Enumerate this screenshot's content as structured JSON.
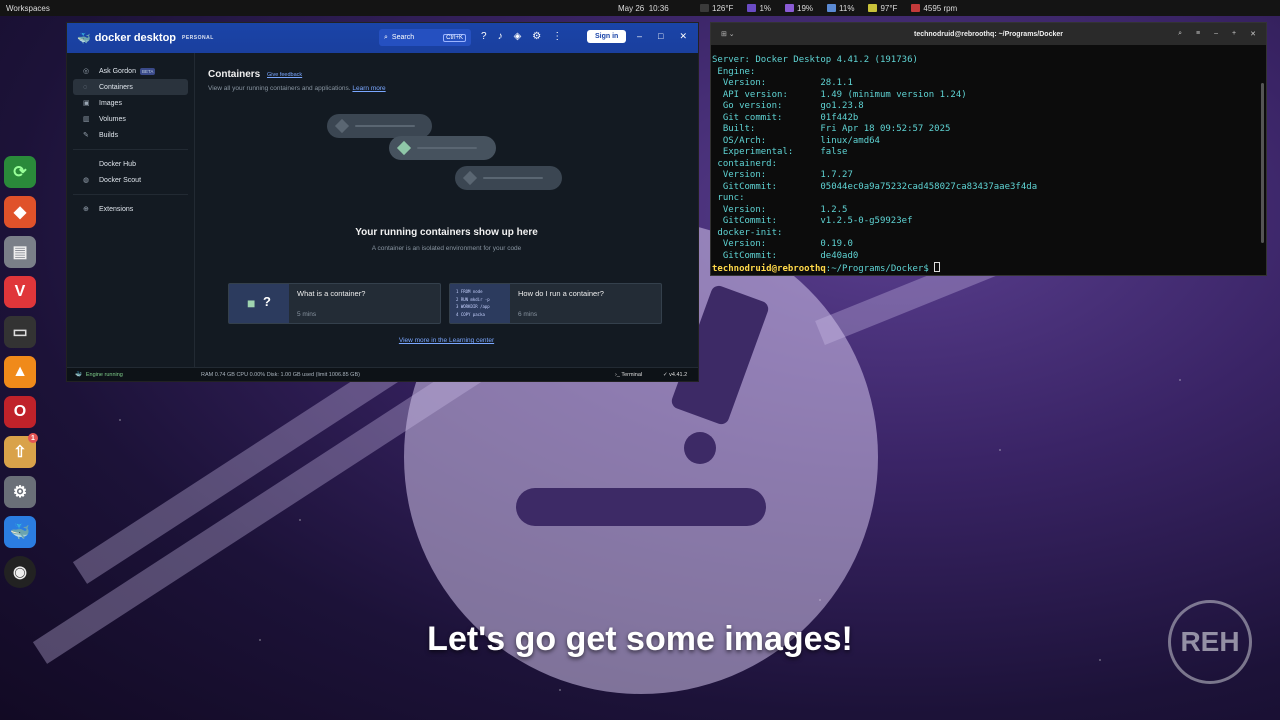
{
  "topbar": {
    "workspaces": "Workspaces",
    "date": "May 26",
    "time": "10:36",
    "temp": "126°F",
    "stats": [
      {
        "label": "cpu",
        "value": "1%"
      },
      {
        "label": "gpu",
        "value": "19%"
      },
      {
        "label": "mem",
        "value": "11%"
      },
      {
        "label": "thermal",
        "value": "97°F"
      },
      {
        "label": "fan",
        "value": "4595 rpm"
      }
    ]
  },
  "dock": {
    "apps": [
      "refresh",
      "brave",
      "files",
      "vivaldi",
      "terminal",
      "vlc",
      "opera",
      "updates",
      "settings",
      "docker",
      "obs"
    ],
    "updates_badge": "1"
  },
  "docker": {
    "brand": "docker desktop",
    "tier": "PERSONAL",
    "search_placeholder": "Search",
    "search_shortcut": "Ctrl+K",
    "sign_in": "Sign in",
    "sidebar": {
      "items": [
        {
          "label": "Ask Gordon",
          "badge": "BETA"
        },
        {
          "label": "Containers"
        },
        {
          "label": "Images"
        },
        {
          "label": "Volumes"
        },
        {
          "label": "Builds"
        },
        {
          "label": "Docker Hub"
        },
        {
          "label": "Docker Scout"
        },
        {
          "label": "Extensions"
        }
      ]
    },
    "main": {
      "title": "Containers",
      "feedback": "Give feedback",
      "subtitle": "View all your running containers and applications.",
      "learn_more": "Learn more",
      "empty_title": "Your running containers show up here",
      "empty_sub": "A container is an isolated environment for your code",
      "cards": [
        {
          "title": "What is a container?",
          "duration": "5 mins"
        },
        {
          "title": "How do I run a container?",
          "duration": "6 mins",
          "code": [
            "1  FROM node",
            "2  RUN mkdir -p",
            "3  WORKDIR /app",
            "4  COPY packa"
          ]
        }
      ],
      "learning_center_link": "View more in the Learning center"
    },
    "status": {
      "engine": "Engine running",
      "resources": "RAM 0.74 GB   CPU 0.00%    Disk: 1.00 GB used (limit 1006.85 GB)",
      "terminal": "Terminal",
      "version": "v4.41.2"
    }
  },
  "terminal": {
    "title": "technodruid@rebroothq: ~/Programs/Docker",
    "lines": [
      "Server: Docker Desktop 4.41.2 (191736)",
      " Engine:",
      "  Version:          28.1.1",
      "  API version:      1.49 (minimum version 1.24)",
      "  Go version:       go1.23.8",
      "  Git commit:       01f442b",
      "  Built:            Fri Apr 18 09:52:57 2025",
      "  OS/Arch:          linux/amd64",
      "  Experimental:     false",
      " containerd:",
      "  Version:          1.7.27",
      "  GitCommit:        05044ec0a9a75232cad458027ca83437aae3f4da",
      " runc:",
      "  Version:          1.2.5",
      "  GitCommit:        v1.2.5-0-g59923ef",
      " docker-init:",
      "  Version:          0.19.0",
      "  GitCommit:        de40ad0"
    ],
    "prompt_user": "technodruid@rebroothq",
    "prompt_path": ":~/Programs/Docker$"
  },
  "caption": "Let's go get some images!",
  "watermark": "REH"
}
